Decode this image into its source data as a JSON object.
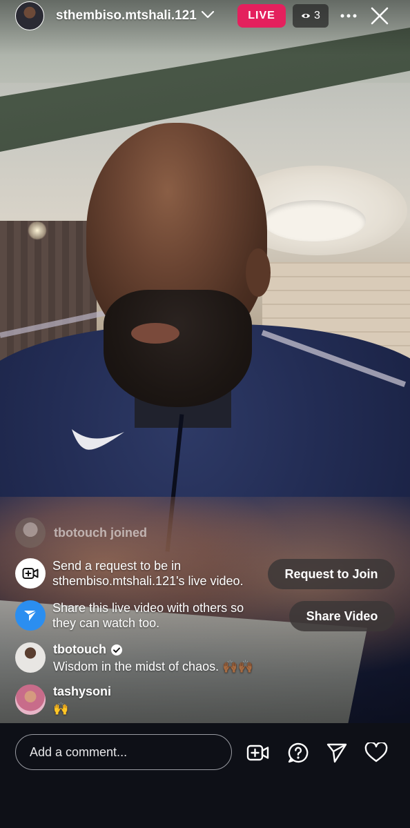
{
  "header": {
    "username": "sthembiso.mtshali.121",
    "live_label": "LIVE",
    "viewer_count": "3",
    "live_color": "#e4205d"
  },
  "feed": {
    "joined_text": "tbotouch joined",
    "request": {
      "line1": "Send a request to be in",
      "line2": "sthembiso.mtshali.121's live video.",
      "button": "Request to Join"
    },
    "share": {
      "line1": "Share this live video with others so",
      "line2": "they can watch too.",
      "button": "Share Video",
      "icon_color": "#2b8ef0"
    },
    "comments": [
      {
        "user": "tbotouch",
        "verified": true,
        "text": "Wisdom in the midst of chaos. 🙌🏾🙌🏾"
      },
      {
        "user": "tashysoni",
        "verified": false,
        "text": "🙌"
      }
    ]
  },
  "bottom": {
    "comment_placeholder": "Add a comment..."
  }
}
